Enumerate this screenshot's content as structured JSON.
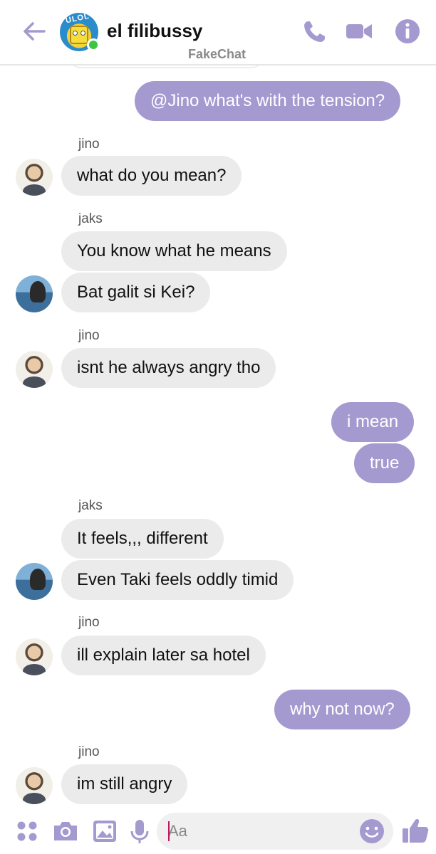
{
  "header": {
    "title": "el filibussy",
    "avatar_text": "ULOL",
    "watermark": "FakeChat",
    "icons": [
      "back-arrow-icon",
      "phone-icon",
      "video-icon",
      "info-icon"
    ],
    "accent_color": "#a59ad0",
    "online_color": "#3ec43e"
  },
  "messages": [
    {
      "side": "out",
      "text": "@Jino what's with the tension?"
    },
    {
      "side": "in",
      "sender": "jino",
      "text": "what do you mean?"
    },
    {
      "side": "in",
      "sender": "jaks",
      "text": "You know what he means"
    },
    {
      "side": "in",
      "text": "Bat galit si Kei?"
    },
    {
      "side": "in",
      "sender": "jino",
      "text": "isnt he always angry tho"
    },
    {
      "side": "out",
      "text": "i mean"
    },
    {
      "side": "out",
      "text": "true"
    },
    {
      "side": "in",
      "sender": "jaks",
      "text": "It feels,,, different"
    },
    {
      "side": "in",
      "text": "Even Taki feels oddly timid"
    },
    {
      "side": "in",
      "sender": "jino",
      "text": "ill explain later sa hotel"
    },
    {
      "side": "out",
      "text": "why not now?"
    },
    {
      "side": "in",
      "sender": "jino",
      "text": "im still angry"
    }
  ],
  "composer": {
    "placeholder": "Aa",
    "icons": [
      "apps-icon",
      "camera-icon",
      "gallery-icon",
      "microphone-icon",
      "emoji-icon",
      "thumbs-up-icon"
    ]
  },
  "colors": {
    "outgoing_bubble": "#a59ad0",
    "incoming_bubble": "#ebebeb"
  }
}
